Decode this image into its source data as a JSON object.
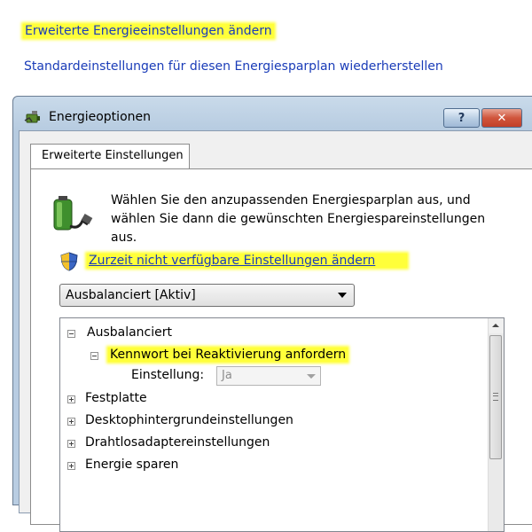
{
  "links": {
    "advanced": "Erweiterte Energieeinstellungen ändern",
    "restore": "Standardeinstellungen für diesen Energiesparplan wiederherstellen"
  },
  "window": {
    "title": "Energieoptionen",
    "help_label": "?",
    "close_label": "✕"
  },
  "tab": {
    "label": "Erweiterte Einstellungen"
  },
  "description": "Wählen Sie den anzupassenden Energiesparplan aus, und wählen Sie dann die gewünschten Energiespareinstellungen aus.",
  "change_link": "Zurzeit nicht verfügbare Einstellungen ändern",
  "plan_select": {
    "value": "Ausbalanciert [Aktiv]"
  },
  "tree": {
    "root": "Ausbalanciert",
    "child": "Kennwort bei Reaktivierung anfordern",
    "setting_label": "Einstellung:",
    "setting_value": "Ja",
    "items": [
      "Festplatte",
      "Desktophintergrundeinstellungen",
      "Drahtlosadaptereinstellungen",
      "Energie sparen"
    ]
  },
  "colors": {
    "highlight": "#ffff3a",
    "link": "#1a3cb8"
  },
  "icons": {
    "titlebar": "power-options-icon",
    "battery": "battery-plug-icon",
    "shield": "uac-shield-icon"
  }
}
